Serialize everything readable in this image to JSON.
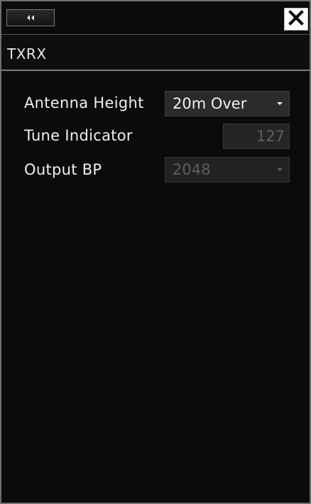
{
  "header": {
    "collapse_icon": "double-chevron-left-icon",
    "close_icon": "close-x-icon"
  },
  "title": "TXRX",
  "fields": {
    "antenna_height": {
      "label": "Antenna Height",
      "value": "20m Over"
    },
    "tune_indicator": {
      "label": "Tune Indicator",
      "value": "127"
    },
    "output_bp": {
      "label": "Output BP",
      "value": "2048"
    }
  },
  "colors": {
    "background": "#0b0b0b",
    "text": "#f0f0f0",
    "disabled_text": "#5f5f5f",
    "close_button_bg": "#ffffff"
  }
}
